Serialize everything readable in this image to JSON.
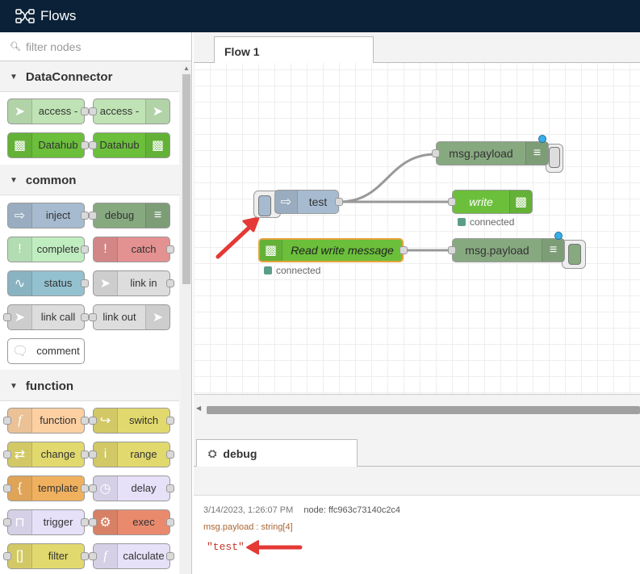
{
  "header": {
    "title": "Flows"
  },
  "palette": {
    "filter_placeholder": "filter nodes",
    "categories": {
      "dataconnector": "DataConnector",
      "common": "common",
      "function": "function"
    },
    "nodes": {
      "access_in": "access -",
      "access_out": "access -",
      "datahub_1": "Datahub",
      "datahub_2": "Datahub",
      "inject": "inject",
      "debug": "debug",
      "complete": "complete",
      "catch": "catch",
      "status": "status",
      "link_in": "link in",
      "link_call": "link call",
      "link_out": "link out",
      "comment": "comment",
      "function": "function",
      "switch": "switch",
      "change": "change",
      "range": "range",
      "template": "template",
      "delay": "delay",
      "trigger": "trigger",
      "exec": "exec",
      "filter": "filter",
      "calculate": "calculate"
    }
  },
  "workspace": {
    "tab": "Flow 1",
    "nodes": {
      "test": "test",
      "msg_payload_1": "msg.payload",
      "write": "write",
      "write_status": "connected",
      "read_write": "Read write message",
      "read_status": "connected",
      "msg_payload_2": "msg.payload"
    }
  },
  "debug_panel": {
    "tab": "debug",
    "timestamp": "3/14/2023, 1:26:07 PM",
    "node": "node: ffc963c73140c2c4",
    "topic": "msg.payload : string[4]",
    "value": "\"test\""
  },
  "colors": {
    "header_bg": "#0b2138",
    "inject": "#a6bbcf",
    "debug": "#87a980",
    "complete": "#c0edc0",
    "catch": "#e49191",
    "status": "#94c1d0",
    "link": "#dddddd",
    "function": "#fdd0a2",
    "switch": "#e2d96e",
    "template": "#f0b15e",
    "delay": "#e6e0f8",
    "exec": "#e98a6d",
    "datahub": "#6bbf3b",
    "access": "#bfe3b4",
    "red_arrow": "#e53935"
  }
}
